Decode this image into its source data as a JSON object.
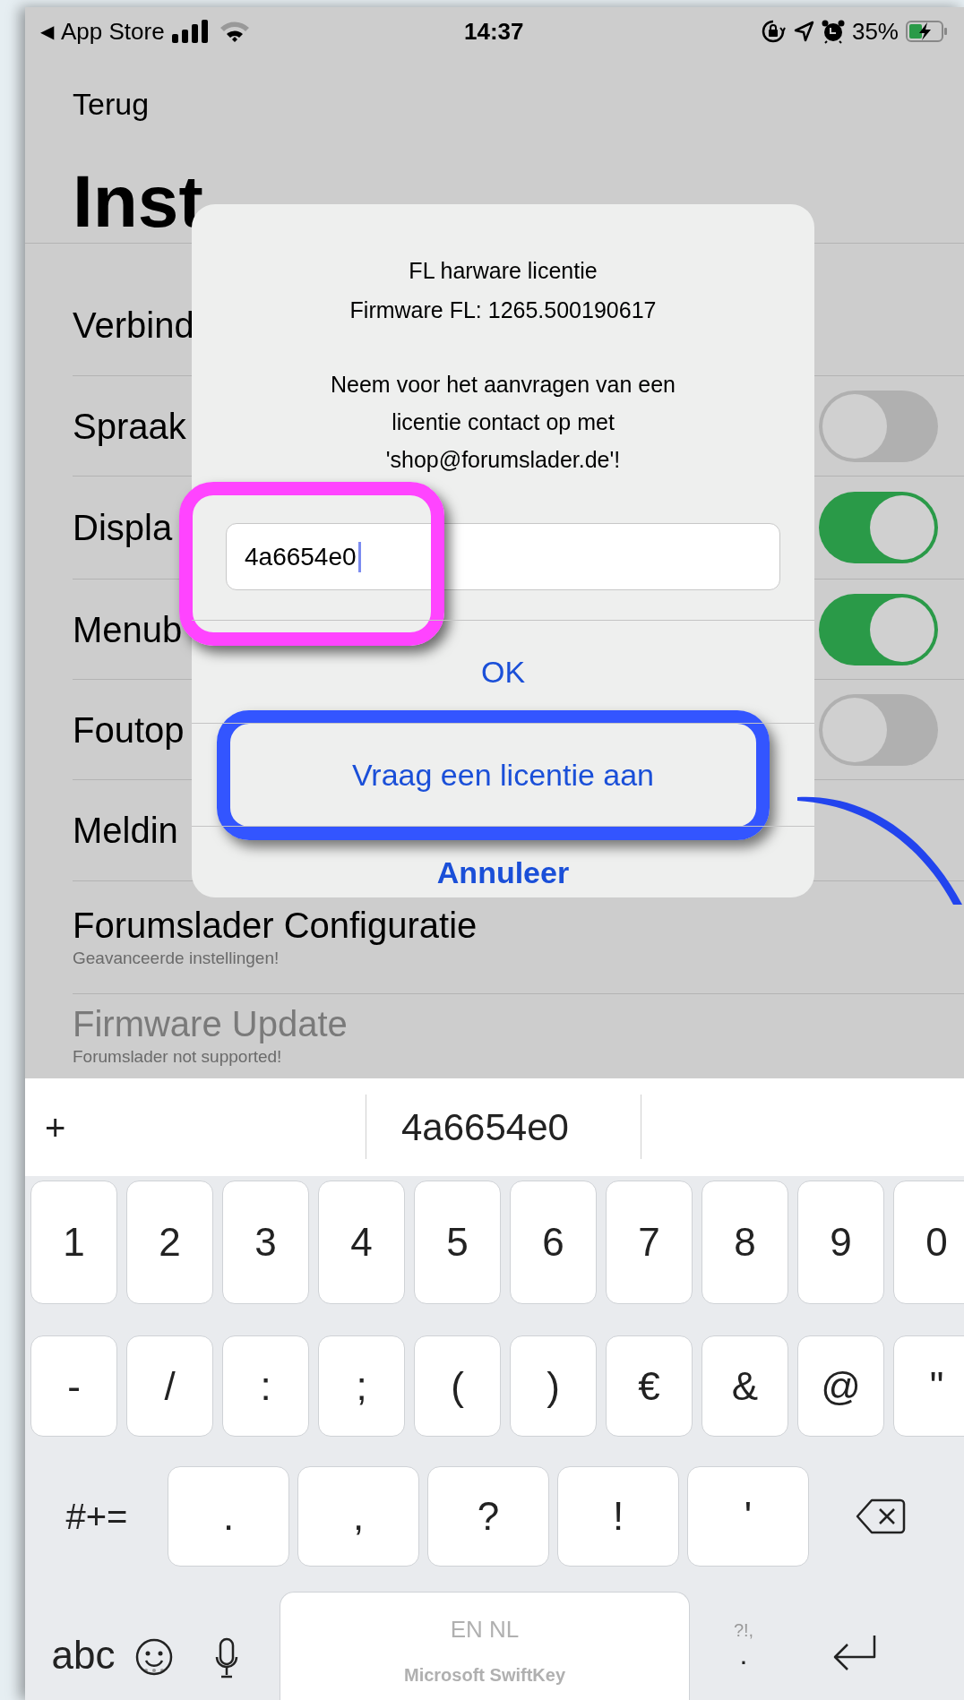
{
  "status_bar": {
    "back_arrow": "◀",
    "back_app": "App Store",
    "time": "14:37",
    "battery": "35%"
  },
  "nav": {
    "back": "Terug",
    "title": "Inst"
  },
  "settings": [
    {
      "label": "Verbind",
      "kind": "plain",
      "disabled": false
    },
    {
      "label": "Spraak",
      "kind": "toggle",
      "on": false,
      "disabled": false
    },
    {
      "label": "Displa",
      "kind": "toggle",
      "on": true,
      "disabled": false
    },
    {
      "label": "Menub",
      "kind": "toggle",
      "on": true,
      "disabled": false
    },
    {
      "label": "Foutop",
      "kind": "toggle",
      "on": false,
      "disabled": false
    },
    {
      "label": "Meldin",
      "kind": "plain",
      "disabled": false
    },
    {
      "label": "Forumslader Configuratie",
      "subtitle": "Geavanceerde instellingen!",
      "kind": "plain",
      "disabled": false
    },
    {
      "label": "Firmware Update",
      "subtitle": "Forumslader not supported!",
      "kind": "plain",
      "disabled": true
    }
  ],
  "dialog": {
    "title_lines": [
      "FL harware licentie",
      "Firmware FL: 1265.500190617"
    ],
    "message": "Neem voor het aanvragen van een licentie contact op met 'shop@forumslader.de'!",
    "field": {
      "value": "4a6654e0"
    },
    "buttons": [
      {
        "label": "OK",
        "kind": "action"
      },
      {
        "label": "Vraag een licentie aan",
        "kind": "action"
      },
      {
        "label": "Annuleer",
        "kind": "cancel"
      }
    ]
  },
  "keyboard": {
    "plus": "+",
    "suggestion": "4a6654e0",
    "rows": [
      [
        "1",
        "2",
        "3",
        "4",
        "5",
        "6",
        "7",
        "8",
        "9",
        "0"
      ],
      [
        "-",
        "/",
        ":",
        ";",
        "(",
        ")",
        "€",
        "&",
        "@",
        "\""
      ]
    ],
    "mode_key": "#+=",
    "punctuation_keys": [
      ".",
      ",",
      "?",
      "!",
      "'"
    ],
    "abc_key": "abc",
    "space_top": "EN NL",
    "space_bottom": "Microsoft SwiftKey",
    "punct_top": "?!,",
    "punct_key": "."
  }
}
